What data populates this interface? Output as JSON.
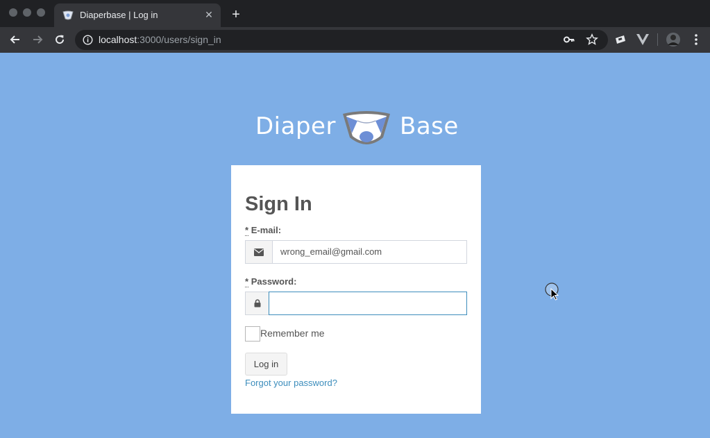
{
  "browser": {
    "tab": {
      "title": "Diaperbase | Log in",
      "close_glyph": "✕"
    },
    "new_tab_glyph": "+",
    "url": {
      "host": "localhost",
      "path": ":3000/users/sign_in"
    }
  },
  "page": {
    "logo": {
      "left_word": "Diaper",
      "right_word": "Base"
    },
    "form": {
      "title": "Sign In",
      "required_mark": "*",
      "email": {
        "label": "E-mail:",
        "value": "wrong_email@gmail.com",
        "icon": "envelope-icon"
      },
      "password": {
        "label": "Password:",
        "value": "",
        "icon": "lock-icon"
      },
      "remember_label": "Remember me",
      "submit_label": "Log in",
      "forgot_link": "Forgot your password?"
    }
  },
  "colors": {
    "page_background": "#7eaee6",
    "link": "#3c8dbc",
    "focus_border": "#3c8dbc"
  }
}
